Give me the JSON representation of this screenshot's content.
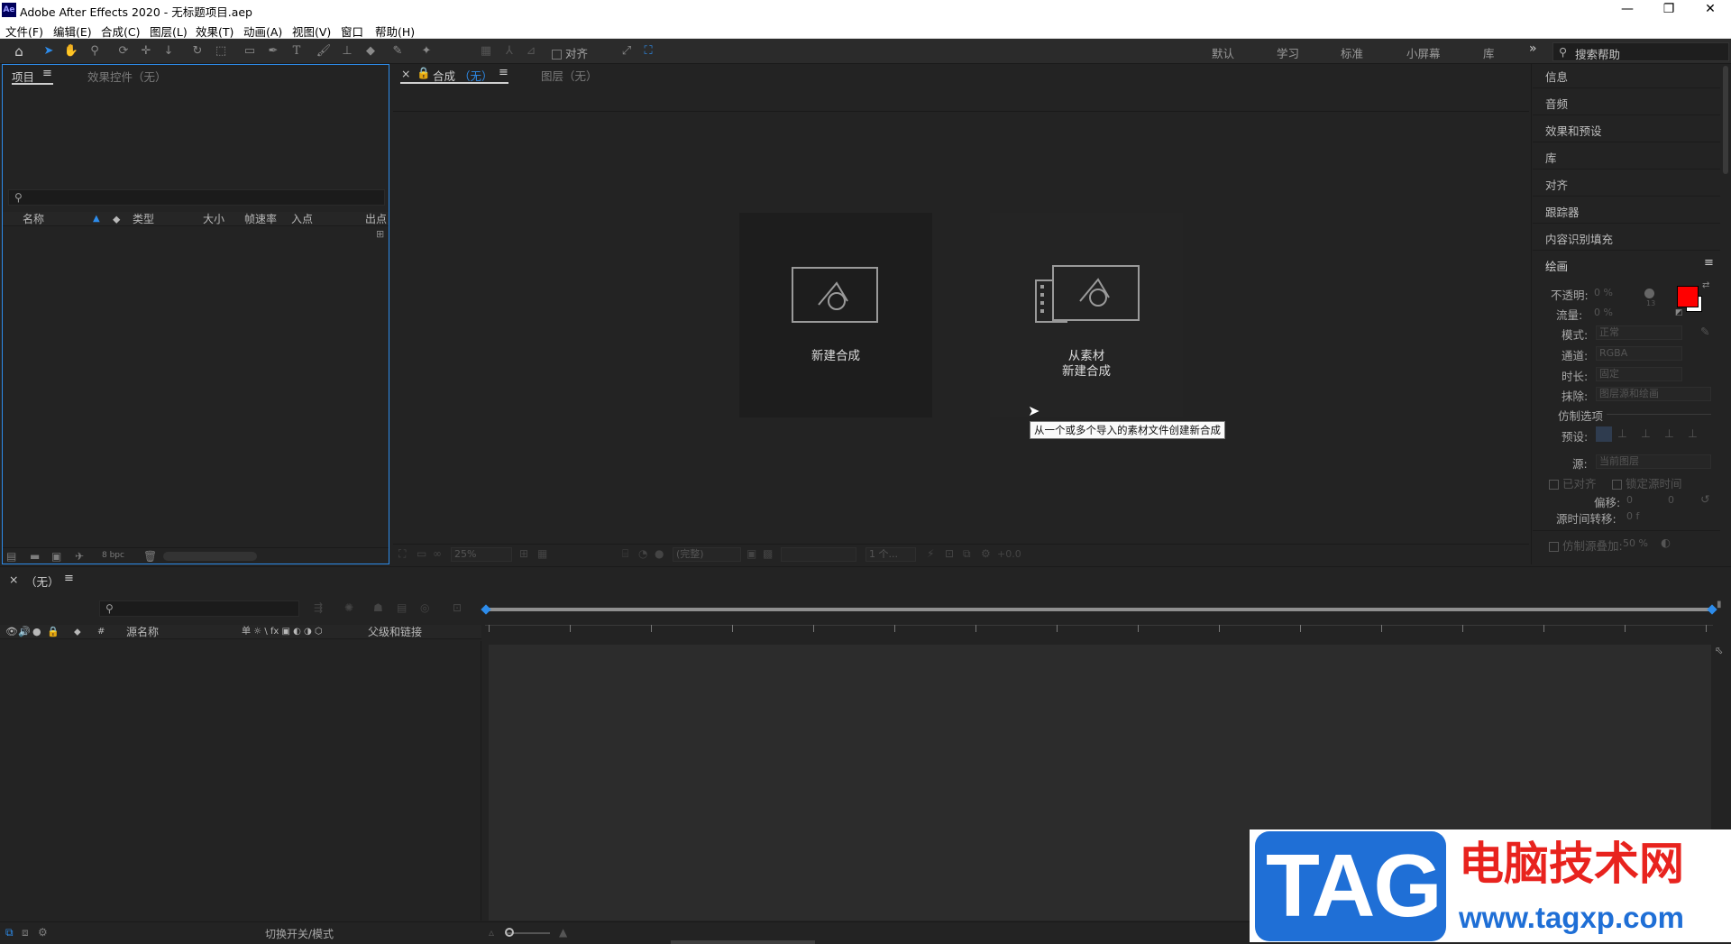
{
  "window": {
    "title": "Adobe After Effects 2020 - 无标题项目.aep",
    "logo_text": "Ae",
    "minimize_glyph": "—",
    "restore_glyph": "❐",
    "close_glyph": "✕"
  },
  "menu": [
    "文件(F)",
    "编辑(E)",
    "合成(C)",
    "图层(L)",
    "效果(T)",
    "动画(A)",
    "视图(V)",
    "窗口",
    "帮助(H)"
  ],
  "toolbar": {
    "align_label": "对齐",
    "workspaces": [
      "默认",
      "学习",
      "标准",
      "小屏幕",
      "库"
    ],
    "more_glyph": "»",
    "search_placeholder": "搜索帮助"
  },
  "project_panel": {
    "tab_project": "项目",
    "tab_effects": "效果控件（无）",
    "columns": [
      "名称",
      "类型",
      "大小",
      "帧速率",
      "入点",
      "出点"
    ],
    "bpc": "8 bpc"
  },
  "comp_panel": {
    "tab_comp": "合成",
    "tab_comp_suffix": "（无）",
    "tab_layer": "图层（无）",
    "new_comp_label": "新建合成",
    "from_footage_line1": "从素材",
    "from_footage_line2": "新建合成",
    "tooltip": "从一个或多个导入的素材文件创建新合成",
    "zoom": "25%",
    "resolution": "(完整)",
    "views": "1 个...",
    "exposure": "+0.0"
  },
  "right_panel": {
    "items": [
      "信息",
      "音频",
      "效果和预设",
      "库",
      "对齐",
      "跟踪器",
      "内容识别填充"
    ],
    "paint_title": "绘画",
    "opacity_label": "不透明:",
    "opacity_value": "0 %",
    "flow_label": "流量:",
    "flow_value": "0 %",
    "mode_label": "模式:",
    "mode_value": "正常",
    "channel_label": "通道:",
    "channel_value": "RGBA",
    "duration_label": "时长:",
    "duration_value": "固定",
    "erase_label": "抹除:",
    "erase_value": "图层源和绘画",
    "clone_options": "仿制选项",
    "preset_label": "预设:",
    "source_label": "源:",
    "source_value": "当前图层",
    "aligned_label": "已对齐",
    "lock_time_label": "锁定源时间",
    "offset_label": "偏移:",
    "offset_x": "0",
    "offset_y": "0",
    "source_time_label": "源时间转移:",
    "source_time_value": "0 f",
    "clone_overlay_label": "仿制源叠加:",
    "clone_overlay_value": "50 %",
    "brush_size": "13",
    "foreground_color": "#ff0000",
    "background_color": "#ffffff"
  },
  "timeline": {
    "tab_label": "（无）",
    "columns": [
      "源名称",
      "父级和链接"
    ],
    "toggle_label": "切换开关/模式",
    "switch_icons": "单 ☼ \\ fx ▣ ◐ ◑ ⬡"
  },
  "watermark": {
    "tag": "TAG",
    "site_name": "电脑技术网",
    "url": "www.tagxp.com"
  }
}
